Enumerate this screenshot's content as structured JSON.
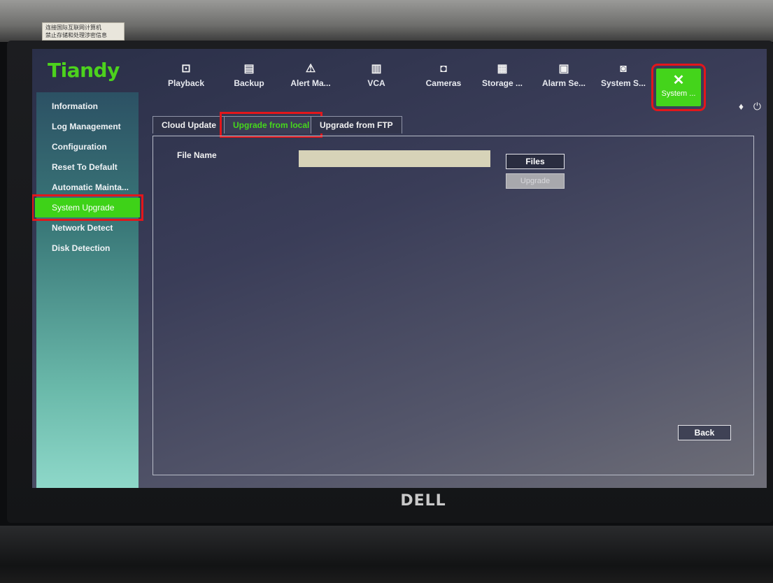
{
  "sticker": {
    "line1": "连接国际互联网计算机",
    "line2": "禁止存储和处理涉密信息"
  },
  "brand": {
    "logo": "Tiandy",
    "monitor": "DELL"
  },
  "topbar": {
    "items": [
      {
        "label": "Playback",
        "icon": "playback-icon"
      },
      {
        "label": "Backup",
        "icon": "save-icon"
      },
      {
        "label": "Alert Ma...",
        "icon": "alert-icon"
      },
      {
        "label": "VCA",
        "icon": "chart-icon"
      },
      {
        "label": "Cameras",
        "icon": "camera-icon"
      },
      {
        "label": "Storage ...",
        "icon": "storage-icon"
      },
      {
        "label": "Alarm Se...",
        "icon": "alarm-icon"
      },
      {
        "label": "System S...",
        "icon": "monitor-icon"
      },
      {
        "label": "System ...",
        "icon": "tools-icon",
        "active": true
      }
    ]
  },
  "sidebar": {
    "items": [
      {
        "label": "Information"
      },
      {
        "label": "Log Management"
      },
      {
        "label": "Configuration"
      },
      {
        "label": "Reset To Default"
      },
      {
        "label": "Automatic Mainta..."
      },
      {
        "label": "System Upgrade",
        "active": true
      },
      {
        "label": "Network Detect"
      },
      {
        "label": "Disk Detection"
      }
    ]
  },
  "tabs": [
    {
      "label": "Cloud Update"
    },
    {
      "label": "Upgrade from local",
      "active": true
    },
    {
      "label": "Upgrade from FTP"
    }
  ],
  "form": {
    "file_name_label": "File Name",
    "file_name_value": "",
    "files_button": "Files",
    "upgrade_button": "Upgrade",
    "back_button": "Back"
  },
  "colors": {
    "accent_green": "#44d41b",
    "highlight_red": "#e3161b"
  }
}
